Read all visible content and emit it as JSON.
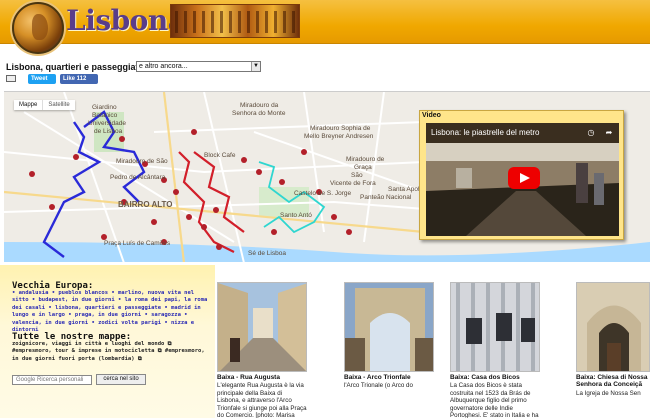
{
  "header": {
    "site_title": "Lisbona"
  },
  "controls": {
    "page_title": "Lisbona, quartieri e passeggiate",
    "select_value": "e altro ancora...",
    "tweet_label": "Tweet",
    "like_label": "Like 112"
  },
  "map": {
    "tab_map": "Mappe",
    "tab_satellite": "Satellite",
    "labels": {
      "giardino": "Giardino",
      "botanico": "Botanico",
      "universidade": "Universidade",
      "de_lisboa": "de Lisboa",
      "miradouro_senhora_monte": "Miradouro da",
      "senhora_monte": "Senhora do Monte",
      "sophia": "Miradouro Sophia de",
      "sophia2": "Mello Breyner Andresen",
      "block_cafe": "Block Cafe",
      "sao_pedro": "Pedro de Alcântara",
      "sao_pedro_pre": "Miradouro de São",
      "bairro_alto": "BAIRRO ALTO",
      "sao_vicente": "São",
      "sao_vicente2": "Vicente de Fora",
      "miradouro_graca": "Miradouro de",
      "graca": "Graça",
      "castelo": "Castelo de S. Jorge",
      "praca_camoes": "Praça Luís de Camões",
      "panteao": "Panteão Nacional",
      "santa_apolonia": "Santa Apolónia",
      "santo_antonio": "Santo Antó",
      "se_lisboa": "Sé de Lisboa"
    }
  },
  "video": {
    "label": "Video",
    "title": "Lisbona: le piastrelle del metro"
  },
  "left": {
    "heading1": "Vecchia Europa:",
    "list1": "• andalusia • pueblos blancos • marlino, nuova vita nel sitto • budapest, in due giorni • la roma dei papi, la roma dei casali • lisbona, quartieri e passeggiate • madrid in lungo e in largo • praga, in due giorni • saragozza • valencia, in due giorni • zodici volta parigi • nizza e dintorni",
    "heading2": "Tutte le nostre mappe:",
    "list2": "zoignicore, viaggi in città e luoghi del mondo ⧉ #empresmoro, tour & imprese in motocicletta ⧉ #empresmoro, in due giorni fuori porta (lombardia) ⧉",
    "search_placeholder": "Google Ricerca personali",
    "search_button": "cerca nel sito"
  },
  "cards": [
    {
      "title": "Baixa - Rua Augusta",
      "text": "L'elegante Rua Augusta è la via principale della Baixa di Lisbona, e attraverso l'Arco Trionfale si giunge poi alla Praça do Comercio. [photo: Marisa"
    },
    {
      "title": "Baixa - Arco Trionfale",
      "text": "l'Arco Trionale (o Arco do"
    },
    {
      "title": "Baixa: Casa dos Bicos",
      "text": "La Casa dos Bicos è stata costruita nel 1523 da Brás de Albuquerque figlio del primo governatore delle Indie Portoghesi. E' stato in Italia e ha"
    },
    {
      "title": "Baixa: Chiesa di Nossa",
      "title2": "Senhora da Conceiçã",
      "text": "La Igreja de Nossa Sen"
    }
  ]
}
